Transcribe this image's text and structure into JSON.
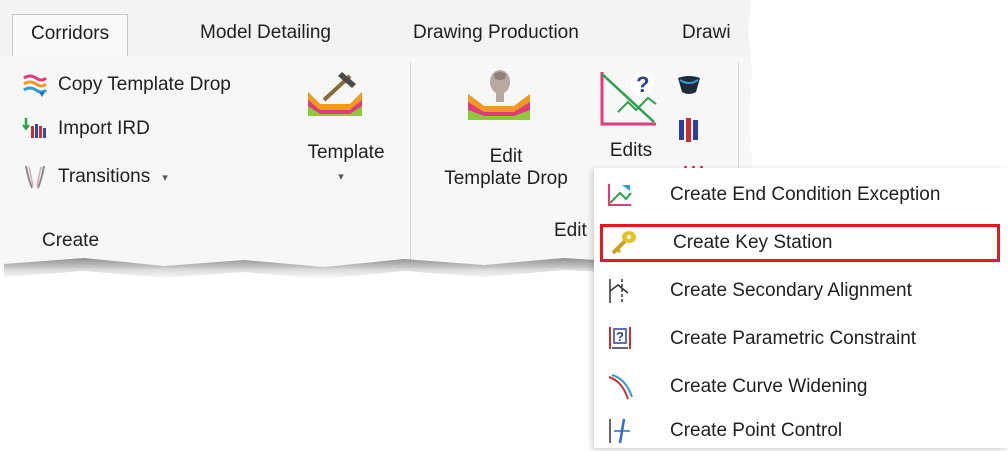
{
  "tabs": [
    "Corridors",
    "Model Detailing",
    "Drawing Production",
    "Drawi"
  ],
  "create_group": {
    "commands": [
      {
        "label": "Copy Template Drop",
        "icon": "copy-template-drop-icon"
      },
      {
        "label": "Import IRD",
        "icon": "import-ird-icon"
      },
      {
        "label": "Transitions",
        "icon": "transitions-icon",
        "dropdown": "▾"
      }
    ],
    "template_label": "Template",
    "template_caret": "▾",
    "label": "Create"
  },
  "edit_group": {
    "edit_template_drop_line1": "Edit",
    "edit_template_drop_line2": "Template Drop",
    "edits_label": "Edits",
    "label": "Edit"
  },
  "menu": {
    "items": [
      {
        "label": "Create End Condition Exception",
        "icon": "end-condition-exception-icon"
      },
      {
        "label": "Create Key Station",
        "icon": "key-icon",
        "highlighted": true
      },
      {
        "label": "Create Secondary Alignment",
        "icon": "secondary-alignment-icon"
      },
      {
        "label": "Create Parametric Constraint",
        "icon": "parametric-constraint-icon"
      },
      {
        "label": "Create Curve Widening",
        "icon": "curve-widening-icon"
      },
      {
        "label": "Create Point Control",
        "icon": "point-control-icon"
      }
    ]
  },
  "colors": {
    "highlight_border": "#e11b1b",
    "accent_orange": "#f29a1f",
    "accent_blue": "#1e73c8"
  }
}
